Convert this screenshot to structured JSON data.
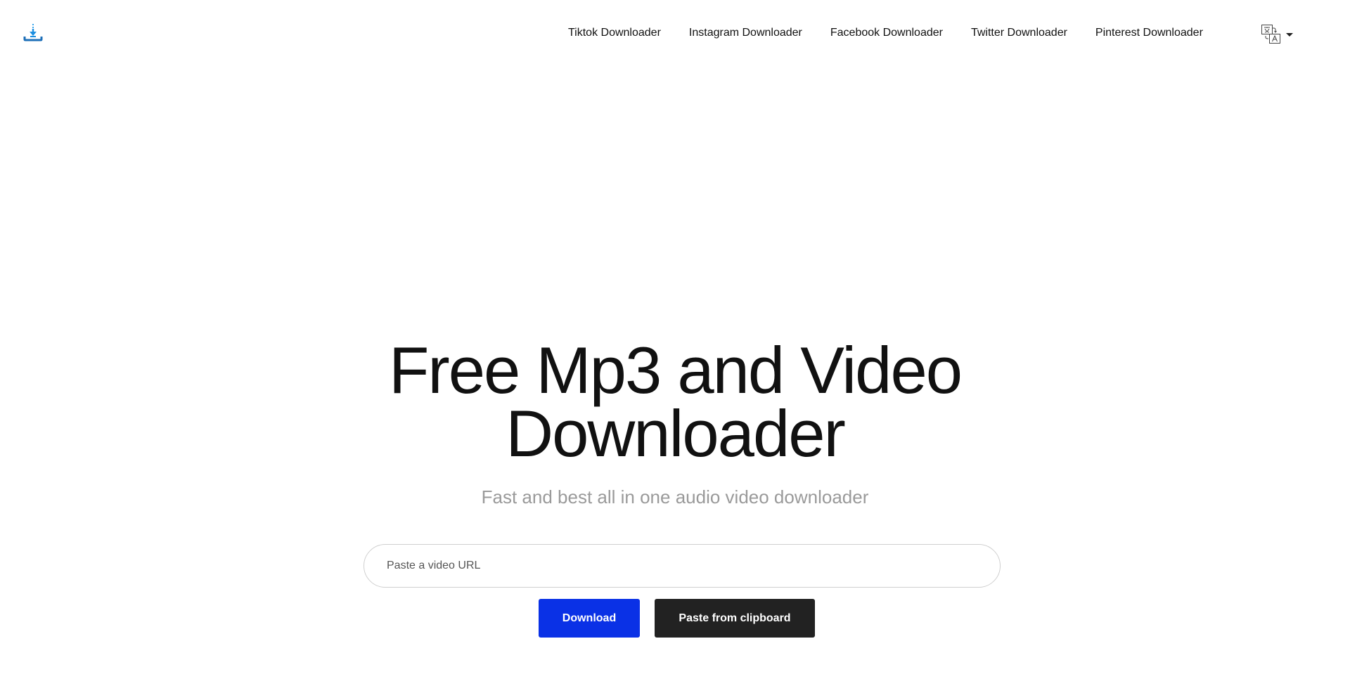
{
  "nav": {
    "items": [
      {
        "label": "Tiktok Downloader"
      },
      {
        "label": "Instagram Downloader"
      },
      {
        "label": "Facebook Downloader"
      },
      {
        "label": "Twitter Downloader"
      },
      {
        "label": "Pinterest Downloader"
      }
    ]
  },
  "icons": {
    "logo": "download-tray-icon",
    "language": "translate-icon",
    "language_caret": "caret-down-icon"
  },
  "hero": {
    "title_line1": "Free Mp3 and Video",
    "title_line2": "Downloader",
    "subtitle": "Fast and best all in one audio video downloader"
  },
  "form": {
    "url_value": "",
    "url_placeholder": "Paste a video URL",
    "download_label": "Download",
    "paste_label": "Paste from clipboard"
  },
  "colors": {
    "accent": "#0a31e6",
    "dark_button": "#222222",
    "logo_blue": "#1d8fe0",
    "subtitle": "#9a9a9a"
  }
}
